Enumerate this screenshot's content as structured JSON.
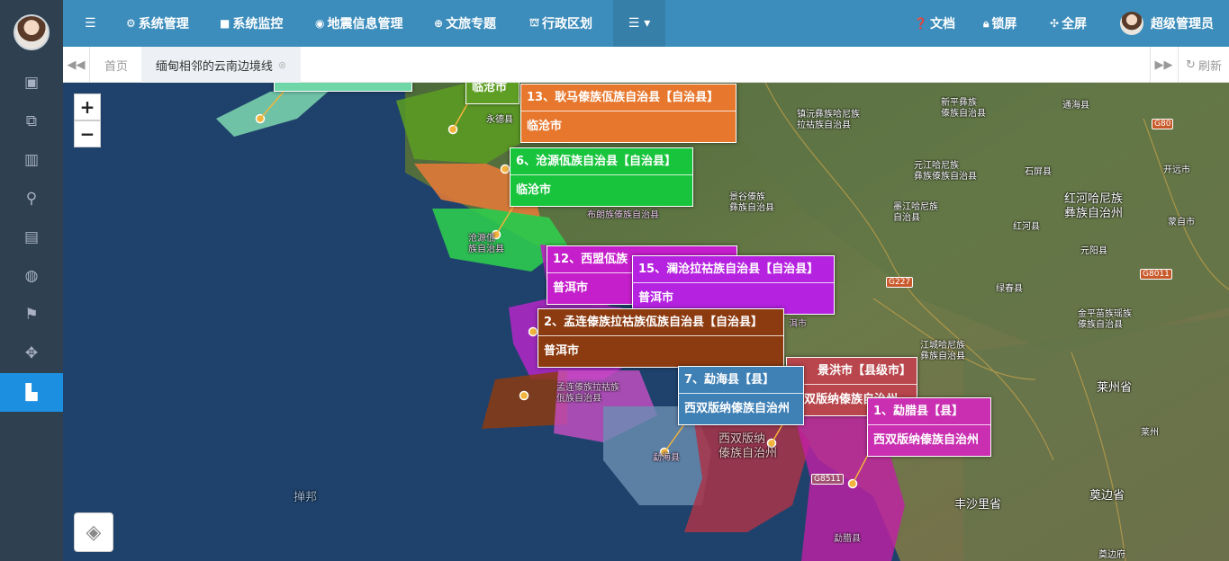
{
  "topbar": {
    "menu": [
      "系统管理",
      "系统监控",
      "地震信息管理",
      "文旅专题",
      "行政区划"
    ],
    "docs": "文档",
    "lock": "锁屏",
    "fullscreen": "全屏",
    "user": "超级管理员"
  },
  "tabs": {
    "home": "首页",
    "active": "缅甸相邻的云南边境线",
    "refresh": "刷新"
  },
  "zoom": {
    "in": "+",
    "out": "−"
  },
  "popups": [
    {
      "title": "13、耿马傣族佤族自治县【自治县】",
      "city": "临沧市",
      "color": "#e7772d"
    },
    {
      "title": "6、沧源佤族自治县【自治县】",
      "city": "临沧市",
      "color": "#19c43d"
    },
    {
      "title": "12、西盟佤族",
      "city": "普洱市",
      "color": "#c51fcb"
    },
    {
      "title": "15、澜沧拉祜族自治县【自治县】",
      "city": "普洱市",
      "color": "#b522e0"
    },
    {
      "title": "2、孟连傣族拉祜族佤族自治县【自治县】",
      "city": "普洱市",
      "color": "#8c3a10"
    },
    {
      "title": "景洪市【县级市】",
      "city": "西双版纳傣族自治州",
      "color": "#b8464c"
    },
    {
      "title": "7、勐海县【县】",
      "city": "西双版纳傣族自治州",
      "color": "#3f80b5"
    },
    {
      "title": "1、勐腊县【县】",
      "city": "西双版纳傣族自治州",
      "color": "#c92fb0"
    },
    {
      "title": "",
      "city": "临沧市",
      "color": "#58a325"
    }
  ],
  "map_labels": {
    "yongde": "永德县",
    "zhenyuan": "镇沅彝族哈尼族\n拉祜族自治县",
    "xinping": "新平彝族\n傣族自治县",
    "tonghai": "通海县",
    "yuanjiang": "元江哈尼族\n彝族傣族自治县",
    "shiping": "石屏县",
    "kaiyuan": "开远市",
    "jinggu": "景谷傣族\n彝族自治县",
    "mojiang": "墨江哈尼族\n自治县",
    "honghe_county": "红河县",
    "honghe": "红河哈尼族\n彝族自治州",
    "mengzi": "蒙自市",
    "yuanyang": "元阳县",
    "lvchun": "绿春县",
    "jinping": "金平苗族瑶族\n傣族自治县",
    "jiangcheng": "江城哈尼族\n彝族自治县",
    "laizhou": "莱州省",
    "laizhou_city": "莱州",
    "fengshali": "丰沙里省",
    "dianbian": "奠边省",
    "dianbianfu": "奠边府",
    "shan": "掸邦",
    "xishuangbanna": "西双版纳\n傣族自治州",
    "mengla": "勐腊县",
    "menghai": "勐海县",
    "menglian": "孟连傣族拉祜族\n佤族自治县",
    "cangyuan": "沧源佤\n族自治县",
    "bulang": "布朗族傣族自治县",
    "g80": "G80",
    "g227": "G227",
    "g8011": "G8011",
    "g8511": "G8511",
    "puer_city": "洱市"
  }
}
